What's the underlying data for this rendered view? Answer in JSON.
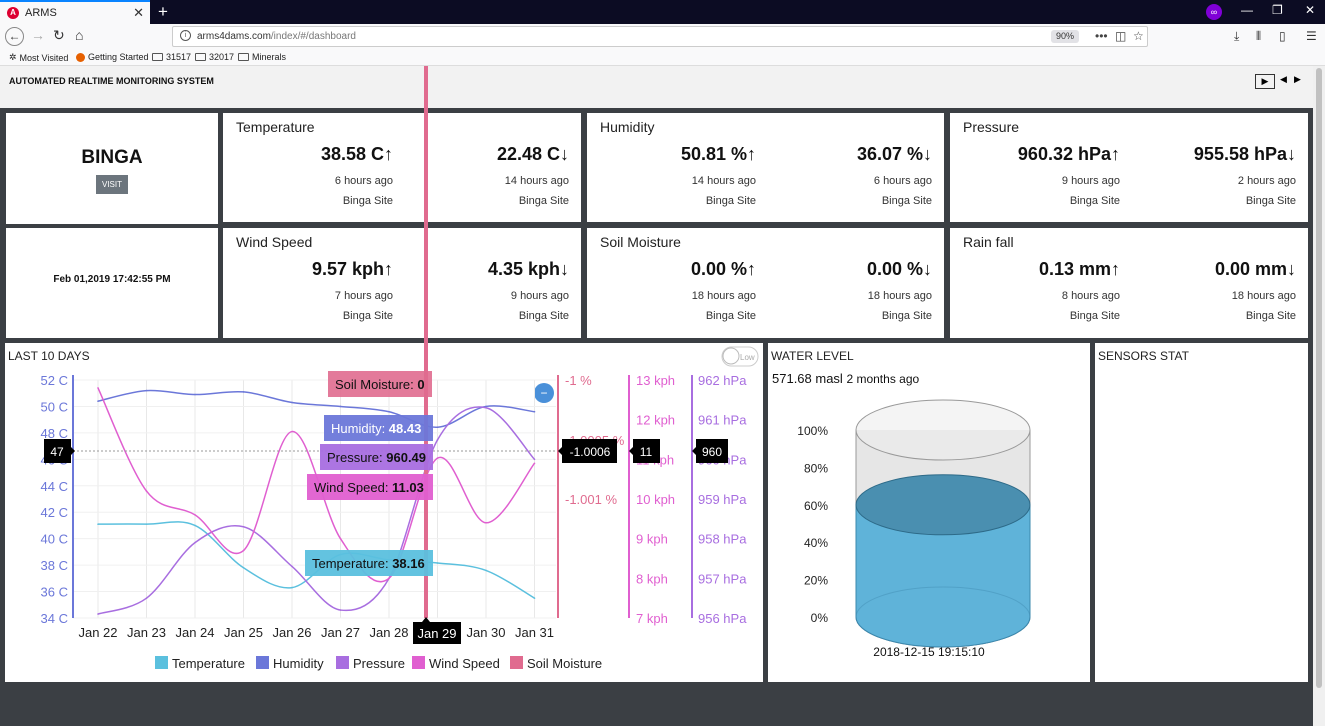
{
  "browser": {
    "tab_title": "ARMS",
    "url_host": "arms4dams.com",
    "url_path": "/index/#/dashboard",
    "zoom": "90%",
    "bookmarks": [
      "Most Visited",
      "Getting Started",
      "31517",
      "32017",
      "Minerals"
    ]
  },
  "header": {
    "title": "AUTOMATED REALTIME MONITORING SYSTEM"
  },
  "site": {
    "name": "BINGA",
    "visit_label": "VISIT",
    "datetime": "Feb 01,2019 17:42:55 PM"
  },
  "cards": [
    {
      "title": "Temperature",
      "max_value": "38.58 C",
      "max_when": "6 hours ago",
      "max_site": "Binga Site",
      "min_value": "22.48 C",
      "min_when": "14 hours ago",
      "min_site": "Binga Site"
    },
    {
      "title": "Humidity",
      "max_value": "50.81 %",
      "max_when": "14 hours ago",
      "max_site": "Binga Site",
      "min_value": "36.07 %",
      "min_when": "6 hours ago",
      "min_site": "Binga Site"
    },
    {
      "title": "Pressure",
      "max_value": "960.32 hPa",
      "max_when": "9 hours ago",
      "max_site": "Binga Site",
      "min_value": "955.58 hPa",
      "min_when": "2 hours ago",
      "min_site": "Binga Site"
    },
    {
      "title": "Wind Speed",
      "max_value": "9.57 kph",
      "max_when": "7 hours ago",
      "max_site": "Binga Site",
      "min_value": "4.35 kph",
      "min_when": "9 hours ago",
      "min_site": "Binga Site"
    },
    {
      "title": "Soil Moisture",
      "max_value": "0.00 %",
      "max_when": "18 hours ago",
      "max_site": "Binga Site",
      "min_value": "0.00 %",
      "min_when": "18 hours ago",
      "min_site": "Binga Site"
    },
    {
      "title": "Rain fall",
      "max_value": "0.13 mm",
      "max_when": "8 hours ago",
      "max_site": "Binga Site",
      "min_value": "0.00 mm",
      "min_when": "18 hours ago",
      "min_site": "Binga Site"
    }
  ],
  "last10": {
    "title": "LAST 10 DAYS",
    "toggle_label": "Low",
    "tooltip": {
      "soil": "Soil Moisture: ",
      "soil_val": "0",
      "hum": "Humidity: ",
      "hum_val": "48.43",
      "pres": "Pressure: ",
      "pres_val": "960.49",
      "wind": "Wind Speed: ",
      "wind_val": "11.03",
      "temp": "Temperature: ",
      "temp_val": "38.16"
    },
    "crosshair": {
      "temp": "47",
      "soil": "-1.0006",
      "wind": "11",
      "pres": "960",
      "date": "Jan 29"
    },
    "legend": [
      "Temperature",
      "Humidity",
      "Pressure",
      "Wind Speed",
      "Soil Moisture"
    ],
    "colors": {
      "temperature": "#5bc0de",
      "humidity": "#6b77d9",
      "pressure": "#a86ee0",
      "wind": "#e05fd0",
      "soil": "#e06b8f"
    }
  },
  "chart_data": {
    "type": "line",
    "x": [
      "Jan 22",
      "Jan 23",
      "Jan 24",
      "Jan 25",
      "Jan 26",
      "Jan 27",
      "Jan 28",
      "Jan 29",
      "Jan 30",
      "Jan 31"
    ],
    "axes": {
      "temperature": {
        "label": "C",
        "ticks": [
          "52 C",
          "50 C",
          "48 C",
          "46 C",
          "44 C",
          "42 C",
          "40 C",
          "38 C",
          "36 C",
          "34 C"
        ],
        "range": [
          34,
          52
        ]
      },
      "soil": {
        "ticks": [
          "-1 %",
          "-1.0005 %",
          "-1.001 %"
        ]
      },
      "wind": {
        "ticks": [
          "13 kph",
          "12 kph",
          "11 kph",
          "10 kph",
          "9 kph",
          "8 kph",
          "7 kph"
        ],
        "range": [
          7,
          13
        ]
      },
      "pressure": {
        "ticks": [
          "962 hPa",
          "961 hPa",
          "960 hPa",
          "959 hPa",
          "958 hPa",
          "957 hPa",
          "956 hPa"
        ],
        "range": [
          956,
          962
        ]
      }
    },
    "series": [
      {
        "name": "Temperature",
        "axis": "temperature",
        "values": [
          41.1,
          41.1,
          41,
          37.8,
          36.3,
          38.8,
          38.4,
          38.16,
          37.6,
          35.5
        ]
      },
      {
        "name": "Humidity",
        "axis": "temperature",
        "values": [
          50.4,
          51.2,
          50.9,
          51.1,
          50.3,
          50,
          49.6,
          48.43,
          50,
          49.6
        ]
      },
      {
        "name": "Pressure",
        "axis": "pressure",
        "values": [
          956.1,
          956.5,
          957.9,
          958.3,
          957.3,
          956.2,
          957,
          960.49,
          961.3,
          960
        ]
      },
      {
        "name": "Wind Speed",
        "axis": "wind",
        "values": [
          12.8,
          10.2,
          9.6,
          8.7,
          11.7,
          9,
          8,
          11.03,
          9.4,
          10.9
        ]
      },
      {
        "name": "Soil Moisture",
        "axis": "soil",
        "values": [
          0,
          0,
          0,
          0,
          0,
          0,
          0,
          0,
          0,
          0
        ]
      }
    ]
  },
  "water": {
    "title": "WATER LEVEL",
    "value": "571.68 masl",
    "ago": "2 months ago",
    "ticks": [
      "100%",
      "80%",
      "60%",
      "40%",
      "20%",
      "0%"
    ],
    "level_percent": 60,
    "timestamp": "2018-12-15 19:15:10"
  },
  "sensors": {
    "title": "SENSORS STAT"
  }
}
